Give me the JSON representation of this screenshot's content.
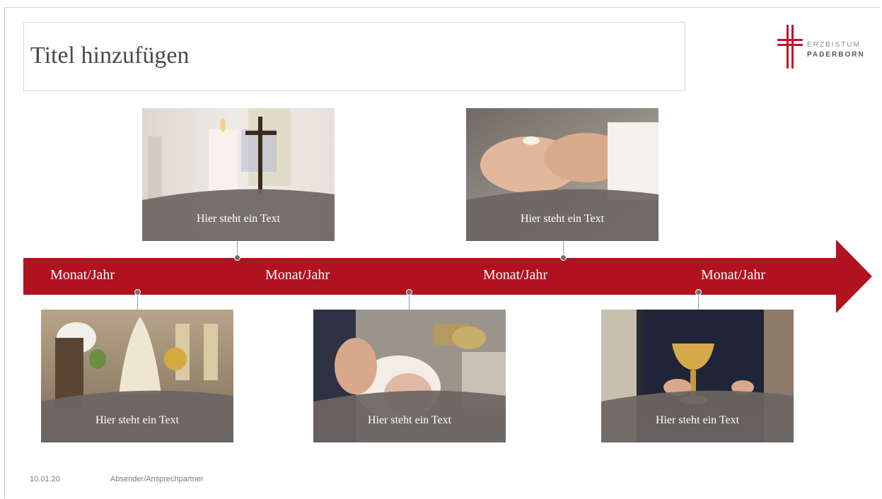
{
  "slide": {
    "title_placeholder": "Titel hinzufügen",
    "logo": {
      "line1": "ERZBISTUM",
      "line2": "PADERBORN",
      "icon": "red-cross-icon",
      "color": "#c0152f"
    },
    "timeline": {
      "arrow_color": "#b0121f",
      "months": [
        "Monat/Jahr",
        "Monat/Jahr",
        "Monat/Jahr",
        "Monat/Jahr"
      ]
    },
    "cards": [
      {
        "caption": "Hier steht ein Text",
        "image": "candle-and-crucifix-photo"
      },
      {
        "caption": "Hier steht ein Text",
        "image": "communion-host-hands-photo"
      },
      {
        "caption": "Hier steht ein Text",
        "image": "church-interior-wedding-photo"
      },
      {
        "caption": "Hier steht ein Text",
        "image": "infant-baptism-photo"
      },
      {
        "caption": "Hier steht ein Text",
        "image": "golden-chalice-photo"
      }
    ],
    "footer": {
      "date": "10.01.20",
      "sender": "Absender/Ansprechpartner"
    }
  }
}
